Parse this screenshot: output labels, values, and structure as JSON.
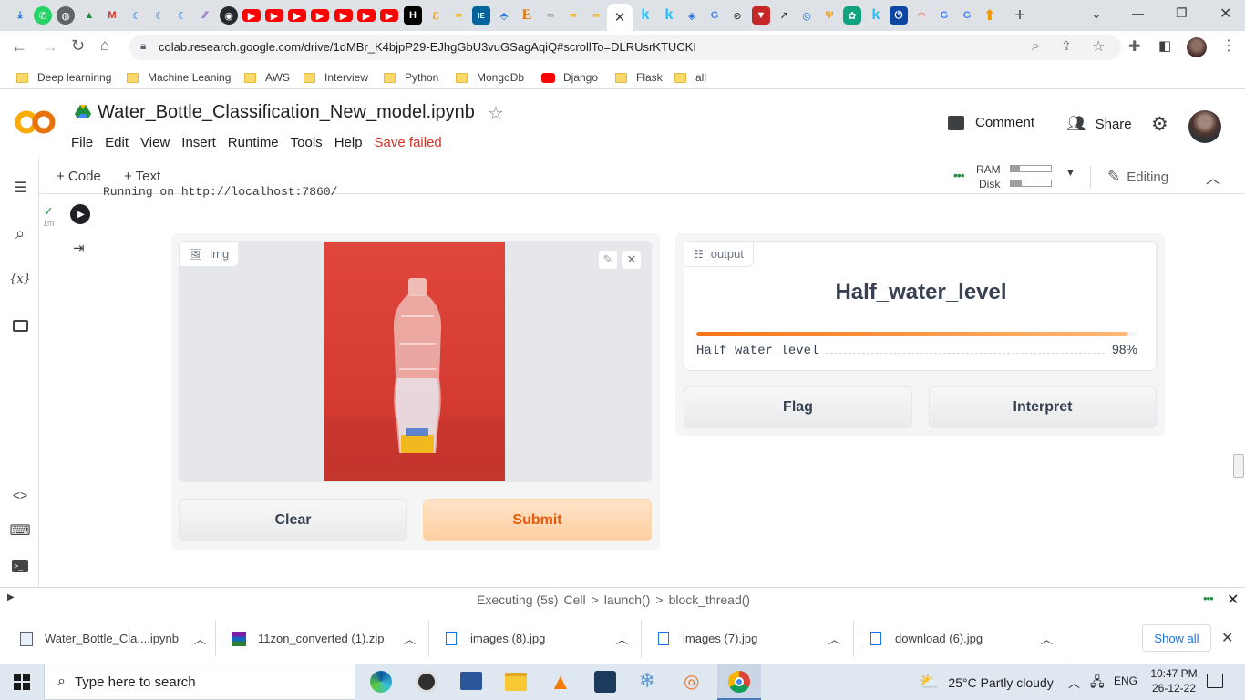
{
  "browser": {
    "url": "colab.research.google.com/drive/1dMBr_K4bjpP29-EJhgGbU3vuGSagAqiQ#scrollTo=DLRUsrKTUCKI",
    "bookmarks": [
      "Deep learninng",
      "Machine Leaning",
      "AWS",
      "Interview",
      "Python",
      "MongoDb",
      "Django",
      "Flask",
      "all"
    ]
  },
  "colab": {
    "notebook_title": "Water_Bottle_Classification_New_model.ipynb",
    "menu": [
      "File",
      "Edit",
      "View",
      "Insert",
      "Runtime",
      "Tools",
      "Help"
    ],
    "save_status": "Save failed",
    "comment_label": "Comment",
    "share_label": "Share",
    "toolbar": {
      "code_label": "+ Code",
      "text_label": "+ Text",
      "ram_label": "RAM",
      "disk_label": "Disk",
      "editing_label": "Editing"
    },
    "cell": {
      "exec_time": "1m",
      "output_snippet": "Running on http://localhost:7860/"
    }
  },
  "gradio": {
    "img_label": "img",
    "output_label": "output",
    "prediction": "Half_water_level",
    "confidences": [
      {
        "label": "Half_water_level",
        "percent_text": "98%",
        "fraction": 0.98
      }
    ],
    "buttons": {
      "clear": "Clear",
      "submit": "Submit",
      "flag": "Flag",
      "interpret": "Interpret"
    }
  },
  "statusbar": {
    "executing": "Executing (5s)",
    "path": [
      "Cell",
      "launch()",
      "block_thread()"
    ]
  },
  "downloads": {
    "items": [
      "Water_Bottle_Cla....ipynb",
      "11zon_converted (1).zip",
      "images (8).jpg",
      "images (7).jpg",
      "download (6).jpg"
    ],
    "show_all": "Show all"
  },
  "taskbar": {
    "search_placeholder": "Type here to search",
    "weather": "25°C  Partly cloudy",
    "lang": "ENG",
    "time": "10:47 PM",
    "date": "26-12-22"
  },
  "colors": {
    "accent_orange": "#f57c00",
    "submit_bg": "#fdd9b5",
    "red_bg": "#d9372f"
  }
}
